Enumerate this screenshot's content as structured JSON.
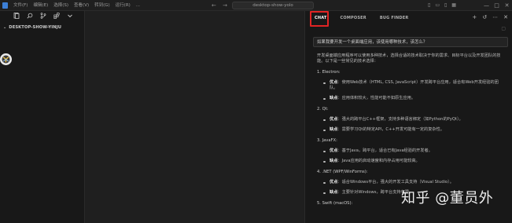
{
  "titlebar": {
    "menu": [
      "文件(F)",
      "编辑(E)",
      "选择(S)",
      "查看(V)",
      "转到(G)",
      "运行(R)",
      "..."
    ],
    "nav_arrows": "← →",
    "command_center": "desktop-show-yolo",
    "window_controls": [
      "—",
      "□",
      "✕"
    ]
  },
  "explorer": {
    "header": "DESKTOP-SHOW-YINJU"
  },
  "chat": {
    "tabs": [
      "CHAT",
      "COMPOSER",
      "BUG FINDER"
    ],
    "active_tab": "CHAT",
    "question": "如果我要开发一个桌面端应用，该使用哪种技术，该怎么？",
    "intro": "开发桌面端应用程序可以使用多种技术，选择合适的技术取决于你的需求、目标平台以及开发团队的技能。以下是一些常见的技术选择：",
    "sections": [
      {
        "title": "1. Electron:",
        "items": [
          {
            "key": "优点",
            "text": "：使用Web技术（HTML, CSS, JavaScript）开发跨平台应用，适合有Web开发经验的团队。"
          },
          {
            "key": "缺点",
            "text": "：应用体积较大，性能可能不如原生应用。"
          }
        ]
      },
      {
        "title": "2. Qt:",
        "items": [
          {
            "key": "优点",
            "text": "：强大的跨平台C++框架，支持多种语言绑定（如Python的PyQt）。"
          },
          {
            "key": "缺点",
            "text": "：需要学习Qt的特定API，C++开发可能有一定的复杂性。"
          }
        ]
      },
      {
        "title": "3. JavaFX:",
        "items": [
          {
            "key": "优点",
            "text": "：基于Java，跨平台，适合已有Java经验的开发者。"
          },
          {
            "key": "缺点",
            "text": "：Java应用的启动速度和内存占用可能较高。"
          }
        ]
      },
      {
        "title": "4. .NET (WPF/WinForms):",
        "items": [
          {
            "key": "优点",
            "text": "：适合Windows平台，强大的开发工具支持（Visual Studio）。"
          },
          {
            "key": "缺点",
            "text": "：主要针对Windows，跨平台支持有限。"
          }
        ]
      },
      {
        "title": "5. Swift (macOS):",
        "items": []
      }
    ]
  },
  "watermark": "知乎 @董员外",
  "colors": {
    "highlight": "#e02424",
    "background": "#181818",
    "editor": "#1f1f1f"
  }
}
